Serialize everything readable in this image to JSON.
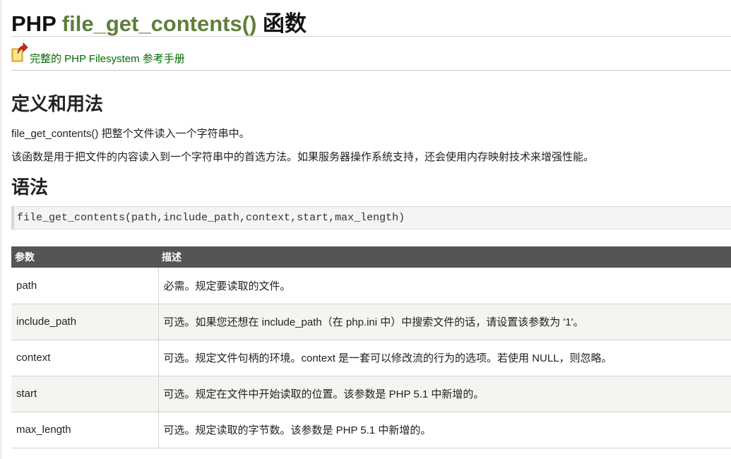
{
  "title": {
    "prefix": "PHP ",
    "function": "file_get_contents()",
    "suffix": " 函数"
  },
  "back_link": {
    "label": "完整的 PHP Filesystem 参考手册",
    "icon": "back-arrow-folder-icon"
  },
  "definition": {
    "heading": "定义和用法",
    "paragraphs": [
      "file_get_contents() 把整个文件读入一个字符串中。",
      "该函数是用于把文件的内容读入到一个字符串中的首选方法。如果服务器操作系统支持，还会使用内存映射技术来增强性能。"
    ]
  },
  "syntax": {
    "heading": "语法",
    "code": "file_get_contents(path,include_path,context,start,max_length)"
  },
  "params_table": {
    "headers": [
      "参数",
      "描述"
    ],
    "rows": [
      {
        "name": "path",
        "desc": "必需。规定要读取的文件。"
      },
      {
        "name": "include_path",
        "desc": "可选。如果您还想在 include_path（在 php.ini 中）中搜索文件的话，请设置该参数为 '1'。"
      },
      {
        "name": "context",
        "desc": "可选。规定文件句柄的环境。context 是一套可以修改流的行为的选项。若使用 NULL，则忽略。"
      },
      {
        "name": "start",
        "desc": "可选。规定在文件中开始读取的位置。该参数是 PHP 5.1 中新增的。"
      },
      {
        "name": "max_length",
        "desc": "可选。规定读取的字节数。该参数是 PHP 5.1 中新增的。"
      }
    ]
  },
  "colors": {
    "function_name": "#5f7f3a",
    "link": "#006b00",
    "table_header_bg": "#555555"
  }
}
